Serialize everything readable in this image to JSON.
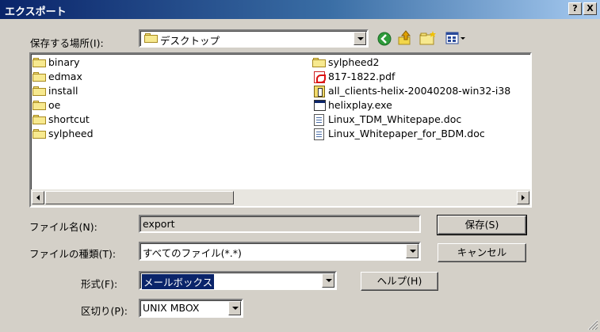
{
  "window": {
    "title": "エクスポート",
    "help_button": "?",
    "close_button": "X"
  },
  "save_location": {
    "label": "保存する場所(I):",
    "value": "デスクトップ"
  },
  "toolbar": {
    "back_icon": "back-arrow-icon",
    "up_icon": "up-folder-icon",
    "new_folder_icon": "new-folder-icon",
    "view_icon": "view-menu-icon"
  },
  "file_list": {
    "left_column": [
      {
        "name": "binary",
        "icon": "folder-icon"
      },
      {
        "name": "edmax",
        "icon": "folder-icon"
      },
      {
        "name": "install",
        "icon": "folder-icon"
      },
      {
        "name": "oe",
        "icon": "folder-icon"
      },
      {
        "name": "shortcut",
        "icon": "folder-icon"
      },
      {
        "name": "sylpheed",
        "icon": "folder-icon"
      }
    ],
    "right_column": [
      {
        "name": "sylpheed2",
        "icon": "folder-icon"
      },
      {
        "name": "817-1822.pdf",
        "icon": "pdf-icon"
      },
      {
        "name": "all_clients-helix-20040208-win32-i38",
        "icon": "zip-icon"
      },
      {
        "name": "helixplay.exe",
        "icon": "exe-icon"
      },
      {
        "name": "Linux_TDM_Whitepape.doc",
        "icon": "doc-icon"
      },
      {
        "name": "Linux_Whitepaper_for_BDM.doc",
        "icon": "doc-icon"
      }
    ]
  },
  "filename": {
    "label": "ファイル名(N):",
    "value": "export"
  },
  "filetype": {
    "label": "ファイルの種類(T):",
    "value": "すべてのファイル(*.*)"
  },
  "format": {
    "label": "形式(F):",
    "value": "メールボックス"
  },
  "delimiter": {
    "label": "区切り(P):",
    "value": "UNIX MBOX"
  },
  "buttons": {
    "save": "保存(S)",
    "cancel": "キャンセル",
    "help": "ヘルプ(H)"
  }
}
